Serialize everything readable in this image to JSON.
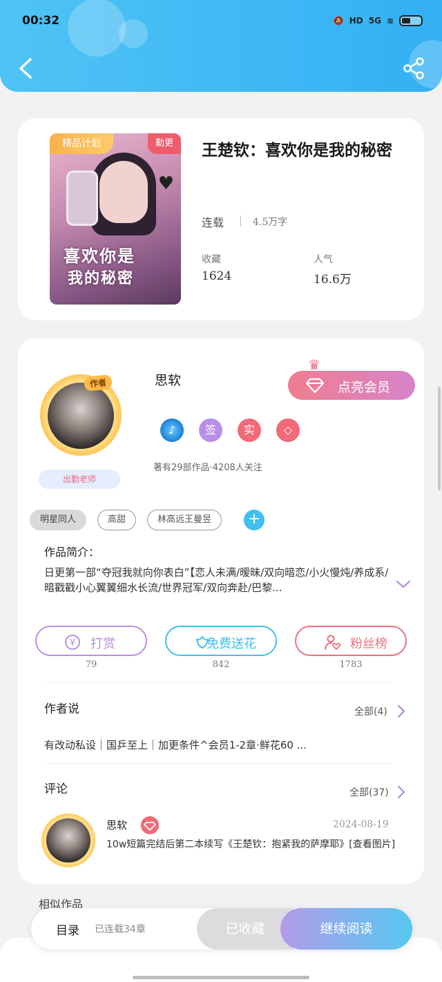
{
  "status_bar": {
    "time": "00:32",
    "network": "5G",
    "hd": "HD"
  },
  "book": {
    "badge_plan": "精品计划",
    "badge_update": "勤更",
    "cover_title_line1": "喜欢你是",
    "cover_title_line2": "我的秘密",
    "title": "王楚钦：喜欢你是我的秘密",
    "status": "连载",
    "word_count": "4.5万字",
    "collect_label": "收藏",
    "collect_value": "1624",
    "popularity_label": "人气",
    "popularity_value": "16.6万"
  },
  "author": {
    "tag": "作者",
    "name": "思软",
    "teacher_label": "出勤老师",
    "vip_button": "点亮会员",
    "badges": [
      "签",
      "实"
    ],
    "works_info": "著有29部作品·4208人关注"
  },
  "tags": [
    "明星同人",
    "高甜",
    "林高远王曼昱"
  ],
  "intro": {
    "heading": "作品简介：",
    "text": "日更第一部“夺冠我就向你表白”【恋人未满/暧昧/双向暗恋/小火慢炖/养成系/暗戳戳小心翼翼细水长流/世界冠军/双向奔赴/巴黎..."
  },
  "actions": [
    {
      "label": "打赏",
      "count": "79",
      "color": "#b78fe0"
    },
    {
      "label": "免费送花",
      "count": "842",
      "color": "#3fc0ee"
    },
    {
      "label": "粉丝榜",
      "count": "1783",
      "color": "#ee7080"
    }
  ],
  "author_says": {
    "heading": "作者说",
    "more": "全部(4)",
    "text": "有改动私设｜国乒至上｜加更条件^会员1-2章·鲜花60 ..."
  },
  "comments": {
    "heading": "评论",
    "more": "全部(37)",
    "items": [
      {
        "name": "思软",
        "date": "2024-08-19",
        "text": "10w短篇完结后第二本续写《王楚钦：抱紧我的萨摩耶》[查看图片]"
      }
    ]
  },
  "similar": {
    "heading": "相似作品"
  },
  "bottom_bar": {
    "toc": "目录",
    "chapters": "已连载34章",
    "collected": "已收藏",
    "continue": "继续阅读"
  },
  "colors": {
    "header": "#33b0f3",
    "accent_pink": "#ee6d86",
    "accent_purple": "#b29be9"
  }
}
